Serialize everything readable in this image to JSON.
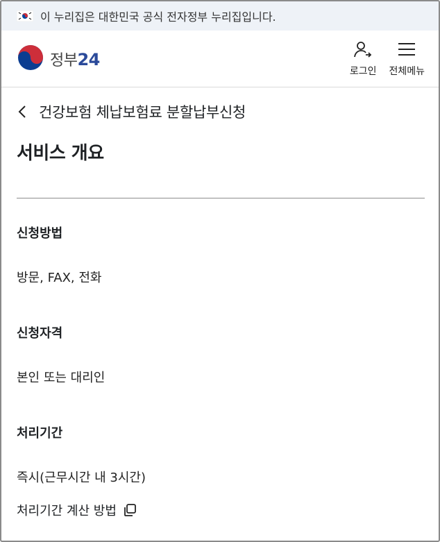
{
  "banner": {
    "text": "이 누리집은 대한민국 공식 전자정부 누리집입니다.",
    "icon": "korea-flag-icon"
  },
  "header": {
    "logo_text": "정부",
    "logo_number": "24",
    "login_label": "로그인",
    "menu_label": "전체메뉴",
    "brand_colors": {
      "red": "#cd2e3a",
      "blue": "#0047a0"
    }
  },
  "page": {
    "title": "건강보험 체납보험료 분할납부신청",
    "section_heading": "서비스 개요"
  },
  "overview": {
    "method_label": "신청방법",
    "method_value": "방문, FAX, 전화",
    "eligibility_label": "신청자격",
    "eligibility_value": "본인 또는 대리인",
    "period_label": "처리기간",
    "period_value": "즉시(근무시간 내 3시간)",
    "period_link": "처리기간 계산 방법"
  }
}
